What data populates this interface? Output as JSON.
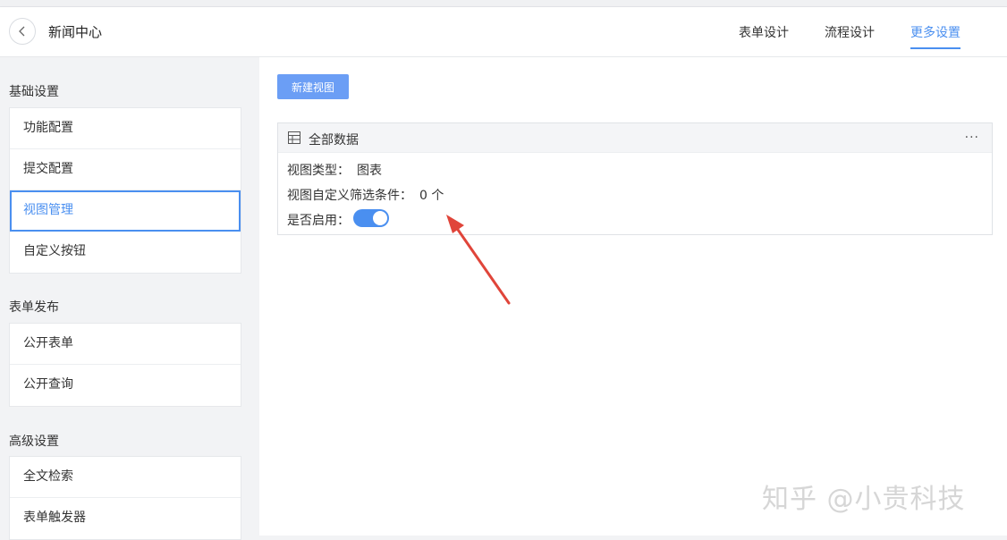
{
  "header": {
    "title": "新闻中心",
    "tabs": [
      "表单设计",
      "流程设计",
      "更多设置"
    ],
    "active_tab": "更多设置"
  },
  "sidebar": {
    "groups": [
      {
        "title": "基础设置",
        "items": [
          "功能配置",
          "提交配置",
          "视图管理",
          "自定义按钮"
        ]
      },
      {
        "title": "表单发布",
        "items": [
          "公开表单",
          "公开查询"
        ]
      },
      {
        "title": "高级设置",
        "items": [
          "全文检索",
          "表单触发器"
        ]
      }
    ],
    "active_item": "视图管理"
  },
  "main": {
    "new_view_button": "新建视图",
    "view_card": {
      "title": "全部数据",
      "more": "···",
      "type_label": "视图类型：",
      "type_value": "图表",
      "filter_label": "视图自定义筛选条件：",
      "filter_value": "0 个",
      "enabled_label": "是否启用：",
      "enabled": true
    }
  },
  "watermark": "知乎 @小贵科技",
  "colors": {
    "accent": "#4a8ff0",
    "button": "#6b9ef5",
    "arrow": "#e0453a"
  }
}
